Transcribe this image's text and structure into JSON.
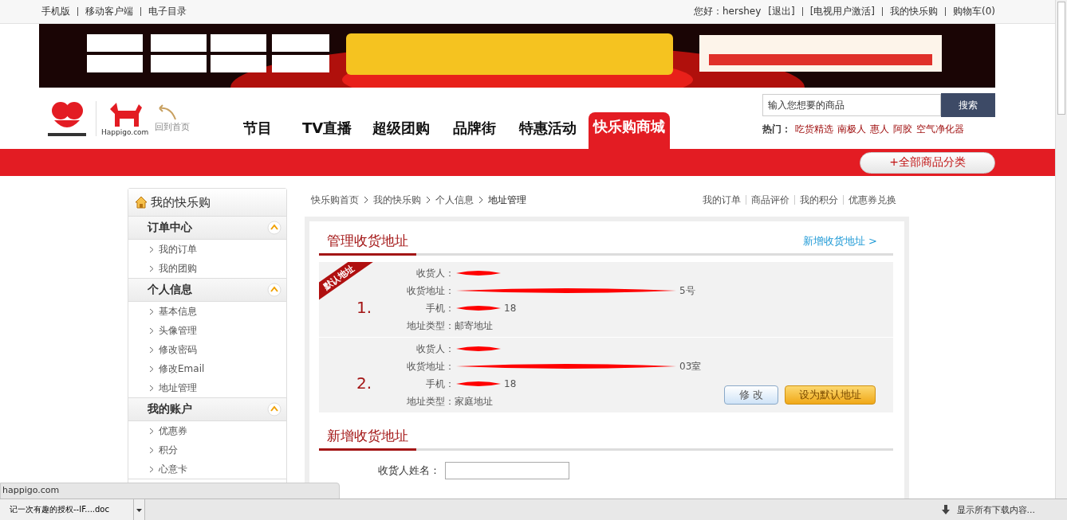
{
  "top_bar": {
    "left_links": [
      "手机版",
      "移动客户端",
      "电子目录"
    ],
    "greeting": "您好：hershey",
    "right_links": [
      "[退出]",
      "[电视用户激活]",
      "我的快乐购",
      "购物车(0)"
    ]
  },
  "banner": {
    "kind": "picture"
  },
  "header": {
    "logo_caption": "Happigo.com",
    "home_link": "回到首页",
    "nav": [
      {
        "label": "节目",
        "selected": false
      },
      {
        "label": "TV直播",
        "selected": false
      },
      {
        "label": "超级团购",
        "selected": false
      },
      {
        "label": "品牌街",
        "selected": false
      },
      {
        "label": "特惠活动",
        "selected": false
      },
      {
        "label": "快乐购商城",
        "selected": true
      }
    ],
    "search": {
      "placeholder": "输入您想要的商品",
      "button": "搜索"
    },
    "hot_label": "热门：",
    "hot_links": [
      "吃货精选",
      "南极人",
      "惠人",
      "阿胶",
      "空气净化器"
    ],
    "all_categories": "+全部商品分类"
  },
  "sidebar": {
    "title": "我的快乐购",
    "sections": [
      {
        "title": "订单中心",
        "expanded": true,
        "items": [
          {
            "label": "我的订单",
            "selected": false
          },
          {
            "label": "我的团购",
            "selected": false
          }
        ]
      },
      {
        "title": "个人信息",
        "expanded": true,
        "items": [
          {
            "label": "基本信息",
            "selected": false
          },
          {
            "label": "头像管理",
            "selected": false
          },
          {
            "label": "修改密码",
            "selected": false
          },
          {
            "label": "修改Email",
            "selected": false
          },
          {
            "label": "地址管理",
            "selected": false
          }
        ]
      },
      {
        "title": "我的账户",
        "expanded": true,
        "items": [
          {
            "label": "优惠券",
            "selected": false
          },
          {
            "label": "积分",
            "selected": false
          },
          {
            "label": "心意卡",
            "selected": false
          }
        ]
      }
    ]
  },
  "breadcrumb": [
    "快乐购首页",
    "我的快乐购",
    "个人信息",
    "地址管理"
  ],
  "quick_links": [
    "我的订单",
    "商品评价",
    "我的积分",
    "优惠券兑换"
  ],
  "manage": {
    "title": "管理收货地址",
    "add_link": "新增收货地址 >",
    "addresses": [
      {
        "number": "1.",
        "default": true,
        "default_badge": "默认地址",
        "fields": [
          {
            "label": "收货人：",
            "redacted": true
          },
          {
            "label": "收货地址：",
            "value": "5号",
            "redacted": true
          },
          {
            "label": "手机：",
            "value": "18",
            "redacted": true
          },
          {
            "label": "地址类型：",
            "value": "邮寄地址"
          }
        ]
      },
      {
        "number": "2.",
        "default": false,
        "fields": [
          {
            "label": "收货人：",
            "redacted": true
          },
          {
            "label": "收货地址：",
            "value": "03室",
            "redacted": true
          },
          {
            "label": "手机：",
            "value": "18",
            "redacted": true
          },
          {
            "label": "地址类型：",
            "value": "家庭地址"
          }
        ],
        "buttons": [
          {
            "label": "修 改",
            "kind": "edit"
          },
          {
            "label": "设为默认地址",
            "kind": "default"
          }
        ]
      }
    ]
  },
  "new_address": {
    "title": "新增收货地址",
    "fields": [
      {
        "label": "收货人姓名："
      }
    ]
  },
  "status_tooltip": "happigo.com",
  "download_bar": {
    "file": "记一次有趣的授权--IF....doc",
    "show_all": "显示所有下载内容..."
  }
}
